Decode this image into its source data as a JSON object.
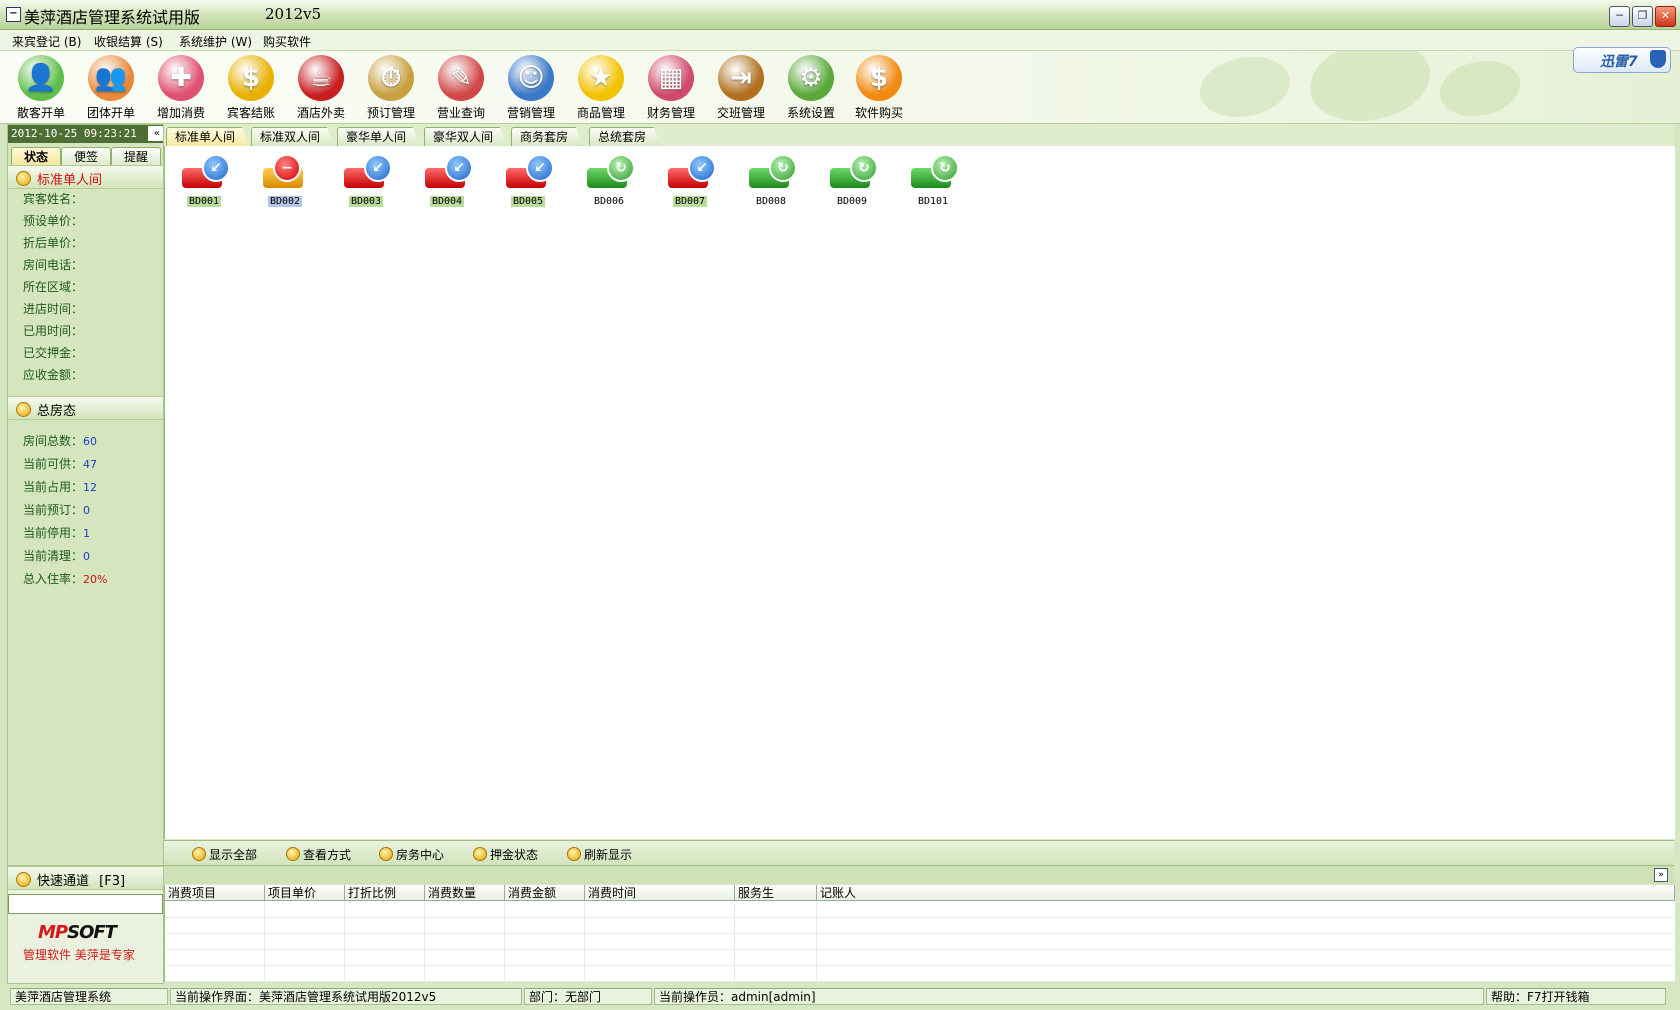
{
  "window": {
    "title": "美萍酒店管理系统试用版",
    "version": "2012v5",
    "min_glyph": "─",
    "max_glyph": "❐",
    "close_glyph": "✕",
    "sys_glyph": "−"
  },
  "menu": [
    {
      "label": "来宾登记 (B)"
    },
    {
      "label": "收银结算 (S)"
    },
    {
      "label": "系统维护 (W)"
    },
    {
      "label": "购买软件"
    }
  ],
  "toolbar": [
    {
      "label": "散客开单",
      "icon": "single-guest-icon",
      "glyph": "👤",
      "color": "#5fbf4a"
    },
    {
      "label": "团体开单",
      "icon": "group-guests-icon",
      "glyph": "👥",
      "color": "#e88a3a"
    },
    {
      "label": "增加消费",
      "icon": "add-consumption-icon",
      "glyph": "✚",
      "color": "#e05070"
    },
    {
      "label": "宾客结账",
      "icon": "checkout-icon",
      "glyph": "$",
      "color": "#e8b000"
    },
    {
      "label": "酒店外卖",
      "icon": "takeout-icon",
      "glyph": "☕",
      "color": "#c82020"
    },
    {
      "label": "预订管理",
      "icon": "reservation-icon",
      "glyph": "⏱",
      "color": "#c8a040"
    },
    {
      "label": "营业查询",
      "icon": "business-query-icon",
      "glyph": "✎",
      "color": "#d04848"
    },
    {
      "label": "营销管理",
      "icon": "marketing-icon",
      "glyph": "☺",
      "color": "#3a78c8"
    },
    {
      "label": "商品管理",
      "icon": "goods-star-icon",
      "glyph": "★",
      "color": "#f2c200"
    },
    {
      "label": "财务管理",
      "icon": "finance-icon",
      "glyph": "▦",
      "color": "#d04a6a"
    },
    {
      "label": "交班管理",
      "icon": "shift-exit-icon",
      "glyph": "⇥",
      "color": "#b07020"
    },
    {
      "label": "系统设置",
      "icon": "settings-gear-icon",
      "glyph": "⚙",
      "color": "#5aa83a"
    },
    {
      "label": "软件购买",
      "icon": "buy-dollar-icon",
      "glyph": "$",
      "color": "#f08a10"
    }
  ],
  "xunlei": {
    "label": "迅雷7"
  },
  "left": {
    "datetime": "2012-10-25 09:23:21",
    "collapse_glyph": "«",
    "tabs": [
      "状态",
      "便签",
      "提醒"
    ],
    "room_section": {
      "title": "标准单人间",
      "fields": [
        "宾客姓名：",
        "预设单价：",
        "折后单价：",
        "房间电话：",
        "所在区域：",
        "进店时间：",
        "已用时间：",
        "已交押金：",
        "应收金额："
      ]
    },
    "summary_section": {
      "title": "总房态",
      "fields": [
        {
          "label": "房间总数：",
          "value": "60"
        },
        {
          "label": "当前可供：",
          "value": "47"
        },
        {
          "label": "当前占用：",
          "value": "12"
        },
        {
          "label": "当前预订：",
          "value": "0"
        },
        {
          "label": "当前停用：",
          "value": "1"
        },
        {
          "label": "当前清理：",
          "value": "0"
        },
        {
          "label": "总入住率：",
          "value": "20%"
        }
      ]
    },
    "quick": {
      "title": "快速通道",
      "hotkey": "[F3]"
    },
    "logo": {
      "mp": "MP",
      "soft": "SOFT"
    },
    "slogan": "管理软件 美萍是专家"
  },
  "room_tabs": [
    "标准单人间",
    "标准双人间",
    "豪华单人间",
    "豪华双人间",
    "商务套房",
    "总统套房"
  ],
  "rooms": [
    {
      "id": "BD001",
      "state": "occupied"
    },
    {
      "id": "BD002",
      "state": "disabled"
    },
    {
      "id": "BD003",
      "state": "occupied"
    },
    {
      "id": "BD004",
      "state": "occupied"
    },
    {
      "id": "BD005",
      "state": "occupied"
    },
    {
      "id": "BD006",
      "state": "available"
    },
    {
      "id": "BD007",
      "state": "occupied"
    },
    {
      "id": "BD008",
      "state": "available"
    },
    {
      "id": "BD009",
      "state": "available"
    },
    {
      "id": "BD101",
      "state": "available"
    }
  ],
  "actions": [
    "显示全部",
    "查看方式",
    "房务中心",
    "押金状态",
    "刷新显示"
  ],
  "consume_collapse_glyph": "»",
  "grid_headers": [
    "消费项目",
    "项目单价",
    "打折比例",
    "消费数量",
    "消费金额",
    "消费时间",
    "服务生",
    "记账人"
  ],
  "status": {
    "app": "美萍酒店管理系统",
    "screen": "当前操作界面：美萍酒店管理系统试用版2012v5",
    "dept": "部门：无部门",
    "operator": "当前操作员：admin[admin]",
    "help": "帮助：F7打开钱箱"
  },
  "colors": {
    "accent": "#4e6f34",
    "panel": "#d5e6bf",
    "highlight": "#b7dc9e"
  }
}
